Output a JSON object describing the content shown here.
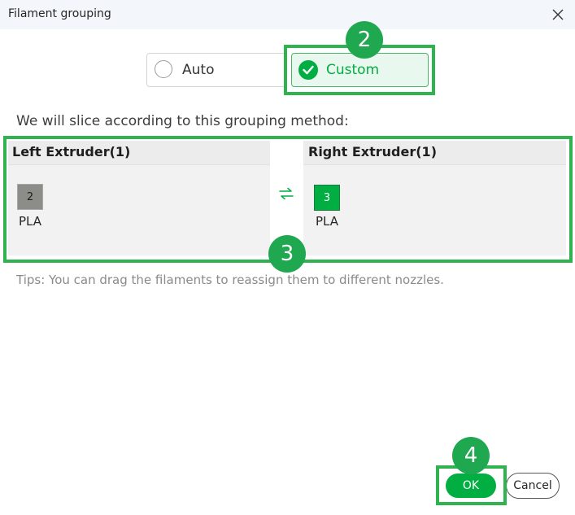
{
  "dialog": {
    "title": "Filament grouping",
    "close_icon": "close-icon"
  },
  "mode": {
    "auto_label": "Auto",
    "custom_label": "Custom",
    "selected": "Custom",
    "accent_color": "#00ae42"
  },
  "description": "We will slice according to this grouping method:",
  "extruders": {
    "left": {
      "title": "Left Extruder(1)",
      "filaments": [
        {
          "number": "2",
          "type": "PLA",
          "color": "#8c8c88"
        }
      ]
    },
    "right": {
      "title": "Right Extruder(1)",
      "filaments": [
        {
          "number": "3",
          "type": "PLA",
          "color": "#00ae42"
        }
      ]
    },
    "swap_icon": "swap-icon"
  },
  "tips": "Tips: You can drag the filaments to reassign them to different nozzles.",
  "buttons": {
    "ok": "OK",
    "cancel": "Cancel"
  },
  "annotations": [
    "2",
    "3",
    "4"
  ],
  "annotation_color": "#2fb34f"
}
